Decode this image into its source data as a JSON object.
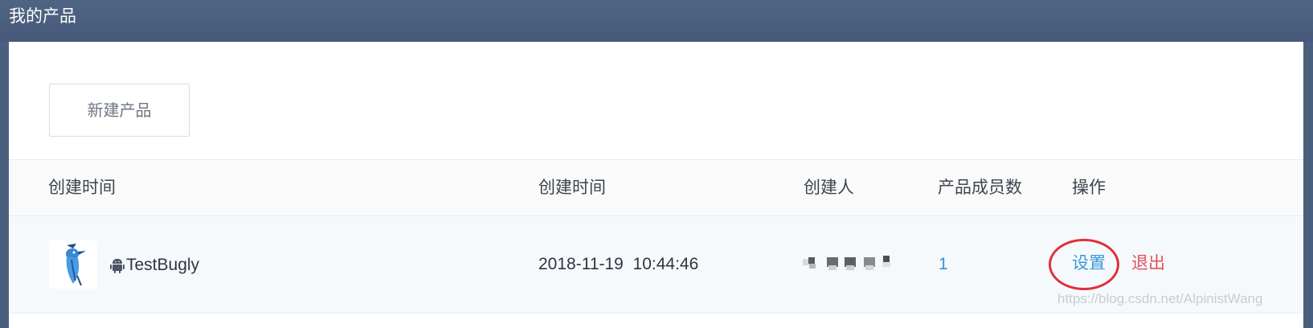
{
  "header": {
    "title": "我的产品"
  },
  "toolbar": {
    "new_product_label": "新建产品"
  },
  "table": {
    "columns": [
      "创建时间",
      "创建时间",
      "创建人",
      "产品成员数",
      "操作"
    ],
    "rows": [
      {
        "app_name": "TestBugly",
        "platform_icon": "android-icon",
        "created_time": "2018-11-19  10:44:46",
        "member_count": "1",
        "actions": {
          "settings": "设置",
          "quit": "退出"
        }
      }
    ]
  },
  "watermark": "https://blog.csdn.net/AlpinistWang",
  "colors": {
    "header_bg": "#4a5f7d",
    "link_blue": "#3a9ad8",
    "quit_red": "#e0505a",
    "annotation_circle": "#e0303a"
  }
}
